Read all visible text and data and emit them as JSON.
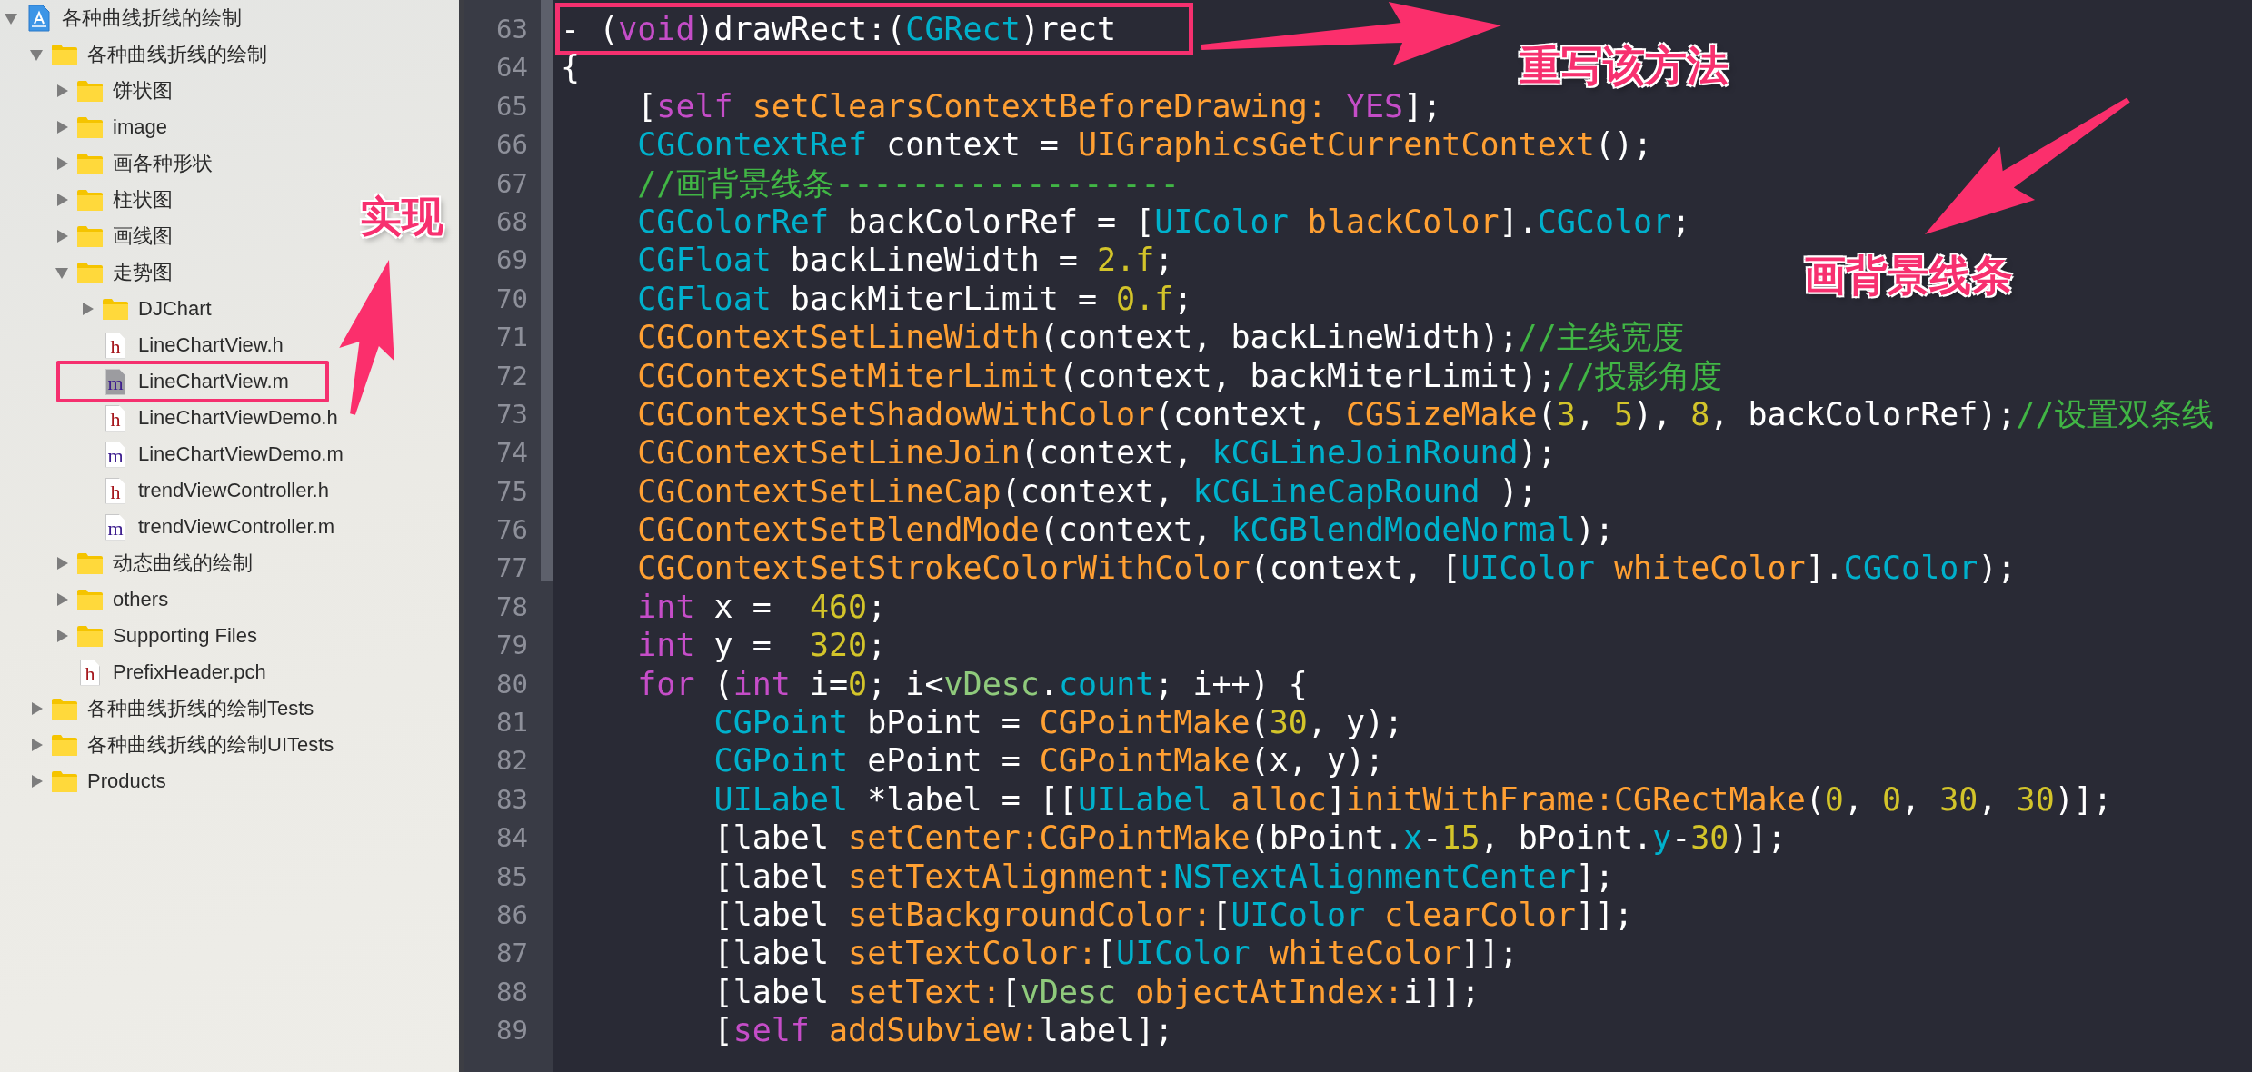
{
  "navigator": {
    "items": [
      {
        "label": "各种曲线折线的绘制",
        "kind": "project",
        "expanded": true,
        "selected": false,
        "annotated": false,
        "children": [
          {
            "label": "各种曲线折线的绘制",
            "kind": "folder",
            "expanded": true,
            "selected": false,
            "annotated": false,
            "children": [
              {
                "label": "饼状图",
                "kind": "folder",
                "expanded": false,
                "selected": false,
                "annotated": false
              },
              {
                "label": "image",
                "kind": "folder",
                "expanded": false,
                "selected": false,
                "annotated": false
              },
              {
                "label": "画各种形状",
                "kind": "folder",
                "expanded": false,
                "selected": false,
                "annotated": false
              },
              {
                "label": "柱状图",
                "kind": "folder",
                "expanded": false,
                "selected": false,
                "annotated": false
              },
              {
                "label": "画线图",
                "kind": "folder",
                "expanded": false,
                "selected": false,
                "annotated": false
              },
              {
                "label": "走势图",
                "kind": "folder",
                "expanded": true,
                "selected": false,
                "annotated": false,
                "children": [
                  {
                    "label": "DJChart",
                    "kind": "folder",
                    "expanded": false,
                    "selected": false,
                    "annotated": false
                  },
                  {
                    "label": "LineChartView.h",
                    "kind": "file",
                    "file_letter": "h",
                    "selected": false,
                    "annotated": false
                  },
                  {
                    "label": "LineChartView.m",
                    "kind": "file",
                    "file_letter": "m",
                    "selected": true,
                    "annotated": true
                  },
                  {
                    "label": "LineChartViewDemo.h",
                    "kind": "file",
                    "file_letter": "h",
                    "selected": false,
                    "annotated": false
                  },
                  {
                    "label": "LineChartViewDemo.m",
                    "kind": "file",
                    "file_letter": "m",
                    "selected": false,
                    "annotated": false
                  },
                  {
                    "label": "trendViewController.h",
                    "kind": "file",
                    "file_letter": "h",
                    "selected": false,
                    "annotated": false
                  },
                  {
                    "label": "trendViewController.m",
                    "kind": "file",
                    "file_letter": "m",
                    "selected": false,
                    "annotated": false
                  }
                ]
              },
              {
                "label": "动态曲线的绘制",
                "kind": "folder",
                "expanded": false,
                "selected": false,
                "annotated": false
              },
              {
                "label": "others",
                "kind": "folder",
                "expanded": false,
                "selected": false,
                "annotated": false
              },
              {
                "label": "Supporting Files",
                "kind": "folder",
                "expanded": false,
                "selected": false,
                "annotated": false
              },
              {
                "label": "PrefixHeader.pch",
                "kind": "file",
                "file_letter": "h",
                "selected": false,
                "annotated": false
              }
            ]
          },
          {
            "label": "各种曲线折线的绘制Tests",
            "kind": "folder",
            "expanded": false,
            "selected": false,
            "annotated": false
          },
          {
            "label": "各种曲线折线的绘制UITests",
            "kind": "folder",
            "expanded": false,
            "selected": false,
            "annotated": false
          },
          {
            "label": "Products",
            "kind": "folder",
            "expanded": false,
            "selected": false,
            "annotated": false
          }
        ]
      }
    ]
  },
  "editor": {
    "lines": [
      {
        "number": "63",
        "highlighted": true,
        "tokens": [
          {
            "text": "- (",
            "kind": "plain"
          },
          {
            "text": "void",
            "kind": "keyword"
          },
          {
            "text": ")drawRect:(",
            "kind": "plain"
          },
          {
            "text": "CGRect",
            "kind": "type"
          },
          {
            "text": ")rect",
            "kind": "plain"
          }
        ]
      },
      {
        "number": "64",
        "highlighted": false,
        "tokens": [
          {
            "text": "{",
            "kind": "plain"
          }
        ]
      },
      {
        "number": "65",
        "highlighted": false,
        "tokens": [
          {
            "text": "    [",
            "kind": "plain"
          },
          {
            "text": "self",
            "kind": "keyword"
          },
          {
            "text": " setClearsContextBeforeDrawing:",
            "kind": "func"
          },
          {
            "text": " YES",
            "kind": "keyword"
          },
          {
            "text": "];",
            "kind": "plain"
          }
        ]
      },
      {
        "number": "66",
        "highlighted": false,
        "tokens": [
          {
            "text": "    CGContextRef",
            "kind": "type"
          },
          {
            "text": " context = ",
            "kind": "plain"
          },
          {
            "text": "UIGraphicsGetCurrentContext",
            "kind": "func"
          },
          {
            "text": "();",
            "kind": "plain"
          }
        ]
      },
      {
        "number": "67",
        "highlighted": false,
        "tokens": [
          {
            "text": "    //画背景线条------------------",
            "kind": "comment"
          }
        ]
      },
      {
        "number": "68",
        "highlighted": false,
        "tokens": [
          {
            "text": "    CGColorRef",
            "kind": "type"
          },
          {
            "text": " backColorRef = [",
            "kind": "plain"
          },
          {
            "text": "UIColor",
            "kind": "type"
          },
          {
            "text": " blackColor",
            "kind": "func"
          },
          {
            "text": "].",
            "kind": "plain"
          },
          {
            "text": "CGColor",
            "kind": "type"
          },
          {
            "text": ";",
            "kind": "plain"
          }
        ]
      },
      {
        "number": "69",
        "highlighted": false,
        "tokens": [
          {
            "text": "    CGFloat",
            "kind": "type"
          },
          {
            "text": " backLineWidth = ",
            "kind": "plain"
          },
          {
            "text": "2.f",
            "kind": "number"
          },
          {
            "text": ";",
            "kind": "plain"
          }
        ]
      },
      {
        "number": "70",
        "highlighted": false,
        "tokens": [
          {
            "text": "    CGFloat",
            "kind": "type"
          },
          {
            "text": " backMiterLimit = ",
            "kind": "plain"
          },
          {
            "text": "0.f",
            "kind": "number"
          },
          {
            "text": ";",
            "kind": "plain"
          }
        ]
      },
      {
        "number": "71",
        "highlighted": false,
        "tokens": [
          {
            "text": "    CGContextSetLineWidth",
            "kind": "func"
          },
          {
            "text": "(context, backLineWidth);",
            "kind": "plain"
          },
          {
            "text": "//主线宽度",
            "kind": "comment"
          }
        ]
      },
      {
        "number": "72",
        "highlighted": false,
        "tokens": [
          {
            "text": "    CGContextSetMiterLimit",
            "kind": "func"
          },
          {
            "text": "(context, backMiterLimit);",
            "kind": "plain"
          },
          {
            "text": "//投影角度",
            "kind": "comment"
          }
        ]
      },
      {
        "number": "73",
        "highlighted": false,
        "tokens": [
          {
            "text": "    CGContextSetShadowWithColor",
            "kind": "func"
          },
          {
            "text": "(context, ",
            "kind": "plain"
          },
          {
            "text": "CGSizeMake",
            "kind": "func"
          },
          {
            "text": "(",
            "kind": "plain"
          },
          {
            "text": "3",
            "kind": "number"
          },
          {
            "text": ", ",
            "kind": "plain"
          },
          {
            "text": "5",
            "kind": "number"
          },
          {
            "text": "), ",
            "kind": "plain"
          },
          {
            "text": "8",
            "kind": "number"
          },
          {
            "text": ", backColorRef);",
            "kind": "plain"
          },
          {
            "text": "//设置双条线",
            "kind": "comment"
          }
        ]
      },
      {
        "number": "74",
        "highlighted": false,
        "tokens": [
          {
            "text": "    CGContextSetLineJoin",
            "kind": "func"
          },
          {
            "text": "(context, ",
            "kind": "plain"
          },
          {
            "text": "kCGLineJoinRound",
            "kind": "type"
          },
          {
            "text": ");",
            "kind": "plain"
          }
        ]
      },
      {
        "number": "75",
        "highlighted": false,
        "tokens": [
          {
            "text": "    CGContextSetLineCap",
            "kind": "func"
          },
          {
            "text": "(context, ",
            "kind": "plain"
          },
          {
            "text": "kCGLineCapRound",
            "kind": "type"
          },
          {
            "text": " );",
            "kind": "plain"
          }
        ]
      },
      {
        "number": "76",
        "highlighted": false,
        "tokens": [
          {
            "text": "    CGContextSetBlendMode",
            "kind": "func"
          },
          {
            "text": "(context, ",
            "kind": "plain"
          },
          {
            "text": "kCGBlendModeNormal",
            "kind": "type"
          },
          {
            "text": ");",
            "kind": "plain"
          }
        ]
      },
      {
        "number": "77",
        "highlighted": false,
        "tokens": [
          {
            "text": "    CGContextSetStrokeColorWithColor",
            "kind": "func"
          },
          {
            "text": "(context, [",
            "kind": "plain"
          },
          {
            "text": "UIColor",
            "kind": "type"
          },
          {
            "text": " whiteColor",
            "kind": "func"
          },
          {
            "text": "].",
            "kind": "plain"
          },
          {
            "text": "CGColor",
            "kind": "type"
          },
          {
            "text": ");",
            "kind": "plain"
          }
        ]
      },
      {
        "number": "78",
        "highlighted": false,
        "tokens": [
          {
            "text": "    int",
            "kind": "keyword"
          },
          {
            "text": " x =  ",
            "kind": "plain"
          },
          {
            "text": "460",
            "kind": "number"
          },
          {
            "text": ";",
            "kind": "plain"
          }
        ]
      },
      {
        "number": "79",
        "highlighted": false,
        "tokens": [
          {
            "text": "    int",
            "kind": "keyword"
          },
          {
            "text": " y =  ",
            "kind": "plain"
          },
          {
            "text": "320",
            "kind": "number"
          },
          {
            "text": ";",
            "kind": "plain"
          }
        ]
      },
      {
        "number": "80",
        "highlighted": false,
        "tokens": [
          {
            "text": "    for",
            "kind": "keyword"
          },
          {
            "text": " (",
            "kind": "plain"
          },
          {
            "text": "int",
            "kind": "keyword"
          },
          {
            "text": " i=",
            "kind": "plain"
          },
          {
            "text": "0",
            "kind": "number"
          },
          {
            "text": "; i<",
            "kind": "plain"
          },
          {
            "text": "vDesc",
            "kind": "variable"
          },
          {
            "text": ".",
            "kind": "plain"
          },
          {
            "text": "count",
            "kind": "type"
          },
          {
            "text": "; i++) {",
            "kind": "plain"
          }
        ]
      },
      {
        "number": "81",
        "highlighted": false,
        "tokens": [
          {
            "text": "        CGPoint",
            "kind": "type"
          },
          {
            "text": " bPoint = ",
            "kind": "plain"
          },
          {
            "text": "CGPointMake",
            "kind": "func"
          },
          {
            "text": "(",
            "kind": "plain"
          },
          {
            "text": "30",
            "kind": "number"
          },
          {
            "text": ", y);",
            "kind": "plain"
          }
        ]
      },
      {
        "number": "82",
        "highlighted": false,
        "tokens": [
          {
            "text": "        CGPoint",
            "kind": "type"
          },
          {
            "text": " ePoint = ",
            "kind": "plain"
          },
          {
            "text": "CGPointMake",
            "kind": "func"
          },
          {
            "text": "(x, y);",
            "kind": "plain"
          }
        ]
      },
      {
        "number": "83",
        "highlighted": false,
        "tokens": [
          {
            "text": "        UILabel",
            "kind": "type"
          },
          {
            "text": " *label = [[",
            "kind": "plain"
          },
          {
            "text": "UILabel",
            "kind": "type"
          },
          {
            "text": " alloc",
            "kind": "func"
          },
          {
            "text": "]",
            "kind": "plain"
          },
          {
            "text": "initWithFrame:",
            "kind": "func"
          },
          {
            "text": "CGRectMake",
            "kind": "func"
          },
          {
            "text": "(",
            "kind": "plain"
          },
          {
            "text": "0",
            "kind": "number"
          },
          {
            "text": ", ",
            "kind": "plain"
          },
          {
            "text": "0",
            "kind": "number"
          },
          {
            "text": ", ",
            "kind": "plain"
          },
          {
            "text": "30",
            "kind": "number"
          },
          {
            "text": ", ",
            "kind": "plain"
          },
          {
            "text": "30",
            "kind": "number"
          },
          {
            "text": ")];",
            "kind": "plain"
          }
        ]
      },
      {
        "number": "84",
        "highlighted": false,
        "tokens": [
          {
            "text": "        [label ",
            "kind": "plain"
          },
          {
            "text": "setCenter:",
            "kind": "func"
          },
          {
            "text": "CGPointMake",
            "kind": "func"
          },
          {
            "text": "(bPoint.",
            "kind": "plain"
          },
          {
            "text": "x",
            "kind": "type"
          },
          {
            "text": "-",
            "kind": "plain"
          },
          {
            "text": "15",
            "kind": "number"
          },
          {
            "text": ", bPoint.",
            "kind": "plain"
          },
          {
            "text": "y",
            "kind": "type"
          },
          {
            "text": "-",
            "kind": "plain"
          },
          {
            "text": "30",
            "kind": "number"
          },
          {
            "text": ")];",
            "kind": "plain"
          }
        ]
      },
      {
        "number": "85",
        "highlighted": false,
        "tokens": [
          {
            "text": "        [label ",
            "kind": "plain"
          },
          {
            "text": "setTextAlignment:",
            "kind": "func"
          },
          {
            "text": "NSTextAlignmentCenter",
            "kind": "type"
          },
          {
            "text": "];",
            "kind": "plain"
          }
        ]
      },
      {
        "number": "86",
        "highlighted": false,
        "tokens": [
          {
            "text": "        [label ",
            "kind": "plain"
          },
          {
            "text": "setBackgroundColor:",
            "kind": "func"
          },
          {
            "text": "[",
            "kind": "plain"
          },
          {
            "text": "UIColor",
            "kind": "type"
          },
          {
            "text": " clearColor",
            "kind": "func"
          },
          {
            "text": "]];",
            "kind": "plain"
          }
        ]
      },
      {
        "number": "87",
        "highlighted": false,
        "tokens": [
          {
            "text": "        [label ",
            "kind": "plain"
          },
          {
            "text": "setTextColor:",
            "kind": "func"
          },
          {
            "text": "[",
            "kind": "plain"
          },
          {
            "text": "UIColor",
            "kind": "type"
          },
          {
            "text": " whiteColor",
            "kind": "func"
          },
          {
            "text": "]];",
            "kind": "plain"
          }
        ]
      },
      {
        "number": "88",
        "highlighted": false,
        "tokens": [
          {
            "text": "        [label ",
            "kind": "plain"
          },
          {
            "text": "setText:",
            "kind": "func"
          },
          {
            "text": "[",
            "kind": "plain"
          },
          {
            "text": "vDesc",
            "kind": "variable"
          },
          {
            "text": " objectAtIndex:",
            "kind": "func"
          },
          {
            "text": "i]];",
            "kind": "plain"
          }
        ]
      },
      {
        "number": "89",
        "highlighted": false,
        "tokens": [
          {
            "text": "        [",
            "kind": "plain"
          },
          {
            "text": "self",
            "kind": "keyword"
          },
          {
            "text": " addSubview:",
            "kind": "func"
          },
          {
            "text": "label];",
            "kind": "plain"
          }
        ]
      }
    ]
  },
  "annotations": [
    {
      "text": "重写该方法"
    },
    {
      "text": "画背景线条"
    },
    {
      "text": "实现"
    }
  ]
}
